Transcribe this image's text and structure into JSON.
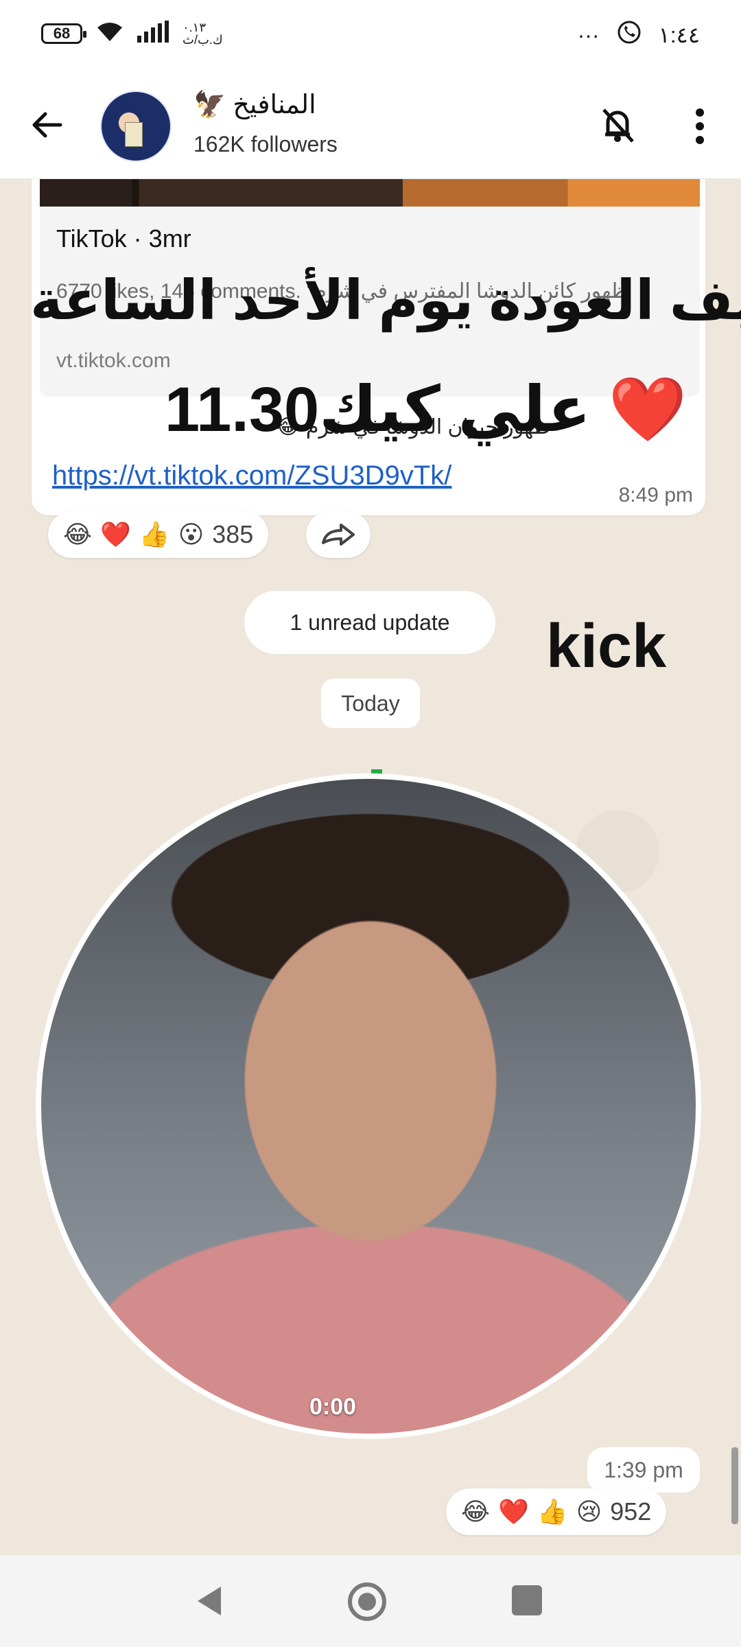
{
  "status_bar": {
    "battery": "68",
    "network_speed": "٠.١٣\nك.ب/ث",
    "more": "···",
    "time": "١:٤٤",
    "icons": [
      "wifi-icon",
      "signal-icon",
      "whatsapp-icon"
    ]
  },
  "header": {
    "channel_name": "المنافيخ",
    "channel_emoji": "🦅",
    "followers": "162K followers",
    "icons": [
      "back-arrow-icon",
      "bell-off-icon",
      "more-vert-icon"
    ]
  },
  "message1": {
    "preview_title": "TikTok · 3mr",
    "preview_desc": "6770 likes, 146 comments. “ظهور كائن الدوشا المفترس في شرم",
    "preview_domain": "vt.tiktok.com",
    "text": "ظهور حيوان الدوشا في شرم 😂",
    "link": "https://vt.tiktok.com/ZSU3D9vTk/",
    "time": "8:49 pm",
    "reactions": {
      "emojis": [
        "😂",
        "❤️",
        "👍",
        "😮"
      ],
      "count": "385"
    }
  },
  "overlay": {
    "line1": "‼️لايف العودة يوم الأحد الساعة",
    "line2": "11.30علي كيك ❤️",
    "kick": "kick"
  },
  "unread_label": "1 unread update",
  "date_label": "Today",
  "message2": {
    "video_duration": "0:00",
    "time": "1:39 pm",
    "reactions": {
      "emojis": [
        "😂",
        "❤️",
        "👍",
        "😢"
      ],
      "count": "952"
    }
  },
  "navbar": {
    "icons": [
      "nav-back-icon",
      "nav-home-icon",
      "nav-recents-icon"
    ]
  }
}
